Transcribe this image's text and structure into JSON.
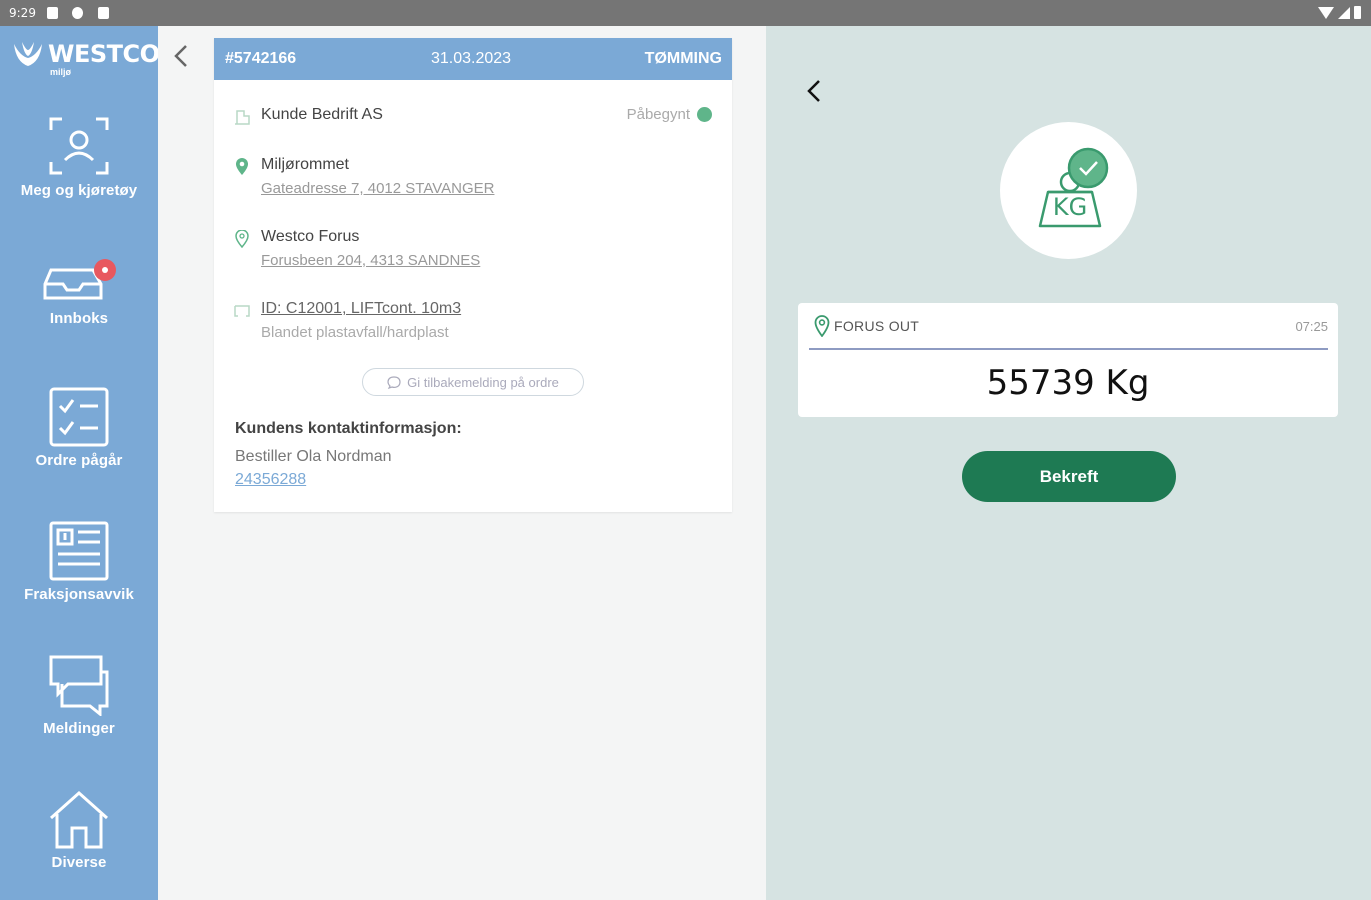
{
  "status_bar": {
    "time": "9:29"
  },
  "sidebar": {
    "logo_text": "WESTCO",
    "logo_sub": "miljø",
    "items": [
      {
        "label": "Meg og kjøretøy",
        "icon": "person-scan-icon"
      },
      {
        "label": "Innboks",
        "icon": "inbox-icon"
      },
      {
        "label": "Ordre pågår",
        "icon": "checklist-icon"
      },
      {
        "label": "Fraksjonsavvik",
        "icon": "report-icon"
      },
      {
        "label": "Meldinger",
        "icon": "chat-icon"
      },
      {
        "label": "Diverse",
        "icon": "home-icon"
      }
    ]
  },
  "order": {
    "id": "#5742166",
    "date": "31.03.2023",
    "type": "TØMMING",
    "customer": "Kunde Bedrift AS",
    "status": "Påbegynt",
    "pickup_name": "Miljørommet",
    "pickup_address": "Gateadresse 7, 4012 STAVANGER",
    "dropoff_name": "Westco Forus",
    "dropoff_address": "Forusbeen 204, 4313 SANDNES",
    "container": "ID: C12001, LIFTcont. 10m3",
    "fraction": "Blandet plastavfall/hardplast",
    "feedback_label": "Gi tilbakemelding på ordre",
    "contact_title": "Kundens kontaktinformasjon:",
    "contact_name": "Bestiller Ola Nordman",
    "contact_phone": "24356288"
  },
  "weighing": {
    "location": "FORUS OUT",
    "time": "07:25",
    "value": "55739 Kg",
    "confirm_label": "Bekreft",
    "kg_icon_text": "KG"
  },
  "colors": {
    "sidebar": "#7ba9d6",
    "accent_green": "#1e7a53",
    "status_green": "#5fb58a",
    "right_bg": "#d6e3e2"
  }
}
